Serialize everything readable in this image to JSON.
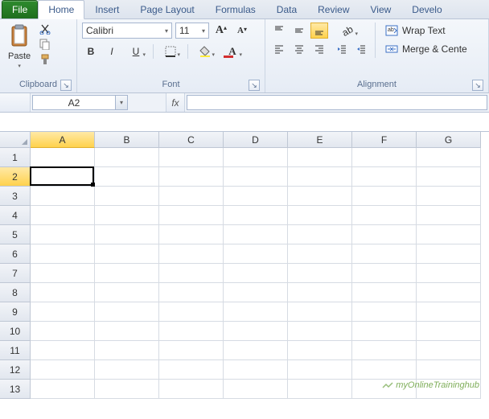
{
  "tabs": {
    "file": "File",
    "home": "Home",
    "insert": "Insert",
    "page_layout": "Page Layout",
    "formulas": "Formulas",
    "data": "Data",
    "review": "Review",
    "view": "View",
    "developer": "Develo"
  },
  "ribbon": {
    "clipboard": {
      "title": "Clipboard",
      "paste": "Paste"
    },
    "font": {
      "title": "Font",
      "name": "Calibri",
      "size": "11",
      "bold": "B",
      "italic": "I",
      "underline": "U",
      "fontcolor_letter": "A"
    },
    "alignment": {
      "title": "Alignment",
      "wrap": "Wrap Text",
      "merge": "Merge & Cente"
    }
  },
  "namebox": "A2",
  "fx_label": "fx",
  "columns": [
    "A",
    "B",
    "C",
    "D",
    "E",
    "F",
    "G"
  ],
  "rows": [
    "1",
    "2",
    "3",
    "4",
    "5",
    "6",
    "7",
    "8",
    "9",
    "10",
    "11",
    "12",
    "13"
  ],
  "selected": {
    "col": "A",
    "row": "2"
  },
  "watermark": "myOnlineTraininghub"
}
